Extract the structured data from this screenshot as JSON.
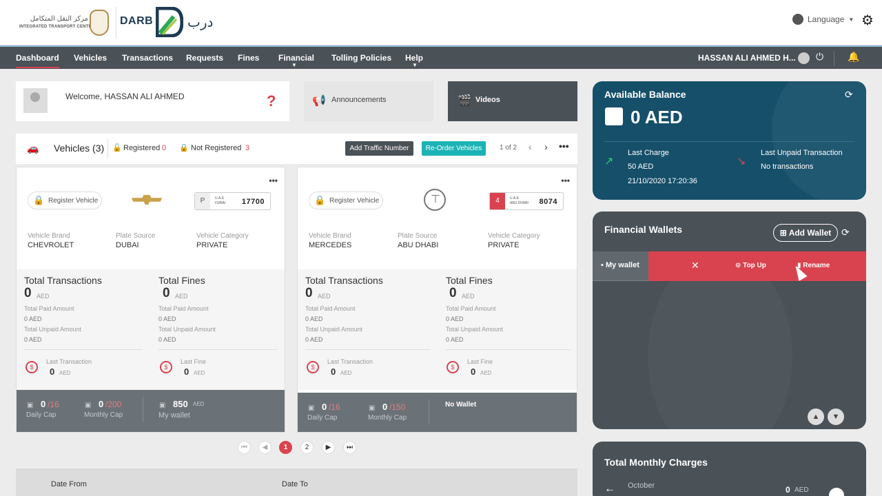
{
  "header": {
    "itc_ar": "مركز النقل المتكامل",
    "itc_en": "INTEGRATED TRANSPORT CENTRE",
    "darb_en": "DARB",
    "darb_ar": "درب",
    "language": "Language",
    "icons": [
      "globe-icon",
      "gear-icon",
      "emblem-icon",
      "darb-logo-icon"
    ]
  },
  "nav": {
    "items": [
      "Dashboard",
      "Vehicles",
      "Transactions",
      "Requests",
      "Fines",
      "Financial",
      "Tolling Policies",
      "Help"
    ],
    "active": "Dashboard",
    "user": "HASSAN ALI AHMED H...",
    "icons": [
      "avatar-icon",
      "power-icon",
      "bell-icon"
    ]
  },
  "welcome": {
    "text": "Welcome, HASSAN ALI AHMED",
    "help": "?"
  },
  "announcements": "Announcements",
  "videos": "Videos",
  "vehicles_bar": {
    "title": "Vehicles (3)",
    "registered_label": "Registered",
    "registered_count": "0",
    "not_registered_label": "Not Registered",
    "not_registered_count": "3",
    "add_traffic": "Add Traffic Number",
    "reorder": "Re-Order Vehicles",
    "page": "1 of 2",
    "more": "•••"
  },
  "cards": [
    {
      "register": "Register Vehicle",
      "plate_code": "P",
      "plate_emirate": "U.A.E\nDUBAI",
      "plate_number": "17700",
      "brand_label": "Vehicle Brand",
      "brand": "CHEVROLET",
      "source_label": "Plate Source",
      "source": "DUBAI",
      "category_label": "Vehicle Category",
      "category": "PRIVATE",
      "total_tx_label": "Total Transactions",
      "total_tx": "0",
      "total_fines_label": "Total Fines",
      "total_fines": "0",
      "unit": "AED",
      "paid_label": "Total Paid Amount",
      "paid": "0 AED",
      "unpaid_label": "Total Unpaid Amount",
      "unpaid": "0 AED",
      "fines_paid": "0 AED",
      "fines_unpaid": "0 AED",
      "last_tx_label": "Last Transaction",
      "last_tx": "0",
      "last_fine_label": "Last Fine",
      "last_fine": "0",
      "daily_val": "0",
      "daily_max": "/16",
      "daily_label": "Daily Cap",
      "monthly_val": "0",
      "monthly_max": "/200",
      "monthly_label": "Monthly Cap",
      "wallet_val": "850",
      "wallet_unit": "AED",
      "wallet_label": "My wallet"
    },
    {
      "register": "Register Vehicle",
      "plate_code": "4",
      "plate_emirate": "U.A.E\nABU DHABI",
      "plate_number": "8074",
      "brand_label": "Vehicle Brand",
      "brand": "MERCEDES",
      "source_label": "Plate Source",
      "source": "ABU DHABI",
      "category_label": "Vehicle Category",
      "category": "PRIVATE",
      "total_tx_label": "Total Transactions",
      "total_tx": "0",
      "total_fines_label": "Total Fines",
      "total_fines": "0",
      "unit": "AED",
      "paid_label": "Total Paid Amount",
      "paid": "0 AED",
      "unpaid_label": "Total Unpaid Amount",
      "unpaid": "0 AED",
      "fines_paid": "0 AED",
      "fines_unpaid": "0 AED",
      "last_tx_label": "Last Transaction",
      "last_tx": "0",
      "last_fine_label": "Last Fine",
      "last_fine": "0",
      "daily_val": "0",
      "daily_max": "/16",
      "daily_label": "Daily Cap",
      "monthly_val": "0",
      "monthly_max": "/150",
      "monthly_label": "Monthly Cap",
      "no_wallet": "No Wallet"
    }
  ],
  "pagination": {
    "first": "⏮",
    "prev": "◀",
    "pages": [
      "1",
      "2"
    ],
    "next": "▶",
    "last": "⏭"
  },
  "date_filter": {
    "from": "Date From",
    "to": "Date To"
  },
  "balance": {
    "title": "Available Balance",
    "amount": "0 AED",
    "last_charge_label": "Last Charge",
    "last_charge_amount": "50 AED",
    "last_charge_date": "21/10/2020 17:20:36",
    "last_unpaid_label": "Last Unpaid Transaction",
    "last_unpaid_value": "No transactions"
  },
  "wallets": {
    "title": "Financial Wallets",
    "add": "Add Wallet",
    "name": "My wallet",
    "topup": "Top Up",
    "rename": "Rename"
  },
  "monthly": {
    "title": "Total Monthly Charges",
    "month": "October",
    "amount": "0",
    "unit": "AED"
  },
  "colors": {
    "accent": "#d9434f",
    "nav": "#4a5157",
    "balance": "#154f6a",
    "teal": "#1bb3b5"
  }
}
